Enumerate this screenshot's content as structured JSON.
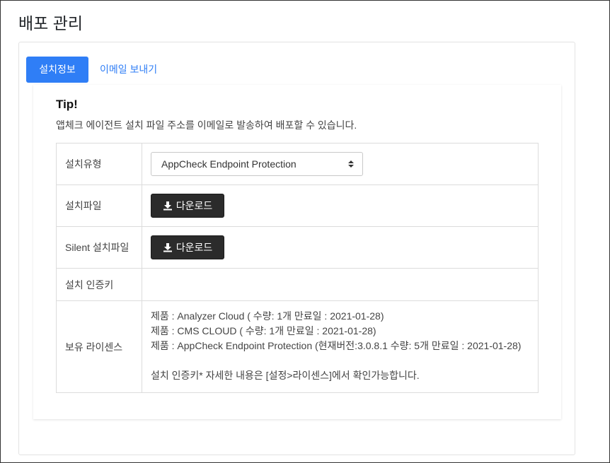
{
  "page": {
    "title": "배포 관리"
  },
  "tabs": [
    {
      "label": "설치정보",
      "active": true
    },
    {
      "label": "이메일 보내기",
      "active": false
    }
  ],
  "tip": {
    "title": "Tip!",
    "description": "앱체크 에이전트 설치 파일 주소를 이메일로 발송하여 배포할 수 있습니다."
  },
  "rows": {
    "install_type": {
      "label": "설치유형",
      "selected": "AppCheck Endpoint Protection"
    },
    "install_file": {
      "label": "설치파일",
      "button": "다운로드"
    },
    "silent_file": {
      "label": "Silent 설치파일",
      "button": "다운로드"
    },
    "auth_key": {
      "label": "설치 인증키",
      "value": ""
    },
    "licenses": {
      "label": "보유 라이센스",
      "lines": [
        "제품 : Analyzer Cloud ( 수량: 1개 만료일 : 2021-01-28)",
        "제품 : CMS CLOUD ( 수량: 1개 만료일 : 2021-01-28)",
        "제품 : AppCheck Endpoint Protection (현재버전:3.0.8.1 수량: 5개 만료일 : 2021-01-28)"
      ],
      "note": "설치 인증키* 자세한 내용은 [설정>라이센스]에서 확인가능합니다."
    }
  },
  "colors": {
    "accent": "#2f7ef6",
    "button_dark": "#2b2b2b"
  },
  "icons": {
    "download": "download-icon",
    "select": "sort-icon"
  }
}
